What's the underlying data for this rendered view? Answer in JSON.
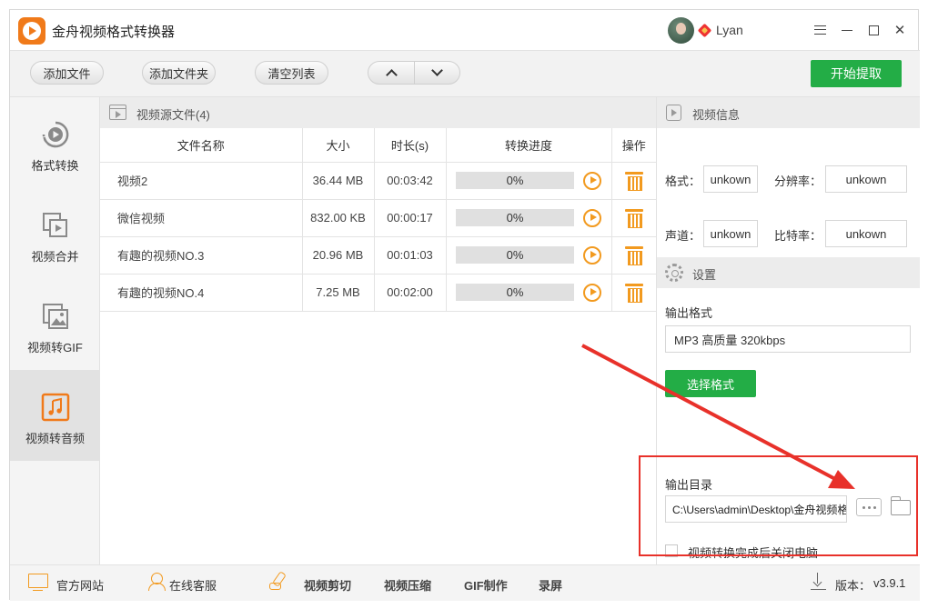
{
  "app": {
    "title": "金舟视频格式转换器"
  },
  "user": {
    "name": "Lyan"
  },
  "toolbar": {
    "add_file": "添加文件",
    "add_folder": "添加文件夹",
    "clear_list": "清空列表",
    "start": "开始提取"
  },
  "sidebar": {
    "items": [
      {
        "label": "格式转换",
        "icon": "format-convert-icon",
        "active": false
      },
      {
        "label": "视频合并",
        "icon": "video-merge-icon",
        "active": false
      },
      {
        "label": "视频转GIF",
        "icon": "video-gif-icon",
        "active": false
      },
      {
        "label": "视频转音频",
        "icon": "music-note-icon",
        "active": true
      }
    ]
  },
  "filelist": {
    "title": "视频源文件(4)",
    "columns": [
      "文件名称",
      "大小",
      "时长(s)",
      "转换进度",
      "操作"
    ],
    "rows": [
      {
        "name": "视频2",
        "size": "36.44 MB",
        "duration": "00:03:42",
        "progress": "0%",
        "progress_value": 0
      },
      {
        "name": "微信视频",
        "size": "832.00 KB",
        "duration": "00:00:17",
        "progress": "0%",
        "progress_value": 0
      },
      {
        "name": "有趣的视频NO.3",
        "size": "20.96 MB",
        "duration": "00:01:03",
        "progress": "0%",
        "progress_value": 0
      },
      {
        "name": "有趣的视频NO.4",
        "size": "7.25 MB",
        "duration": "00:02:00",
        "progress": "0%",
        "progress_value": 0
      }
    ]
  },
  "info": {
    "title": "视频信息",
    "format_label": "格式：",
    "format_value": "unkown",
    "resolution_label": "分辨率：",
    "resolution_value": "unkown",
    "audio_label": "声道：",
    "audio_value": "unkown",
    "bitrate_label": "比特率：",
    "bitrate_value": "unkown"
  },
  "settings": {
    "title": "设置",
    "output_format_label": "输出格式",
    "output_format_value": "MP3 高质量 320kbps",
    "choose_format": "选择格式",
    "output_dir_label": "输出目录",
    "output_dir_value": "C:\\Users\\admin\\Desktop\\金舟视频格式转换器",
    "shutdown_label": "视频转换完成后关闭电脑",
    "shutdown_checked": false
  },
  "footer": {
    "website": "官方网站",
    "support": "在线客服",
    "video_cut": "视频剪切",
    "video_compress": "视频压缩",
    "gif_make": "GIF制作",
    "record": "录屏",
    "version_label": "版本：",
    "version": "v3.9.1"
  },
  "colors": {
    "accent_green": "#23ad46",
    "accent_orange": "#f29a1f",
    "annotation_red": "#e8312a"
  }
}
